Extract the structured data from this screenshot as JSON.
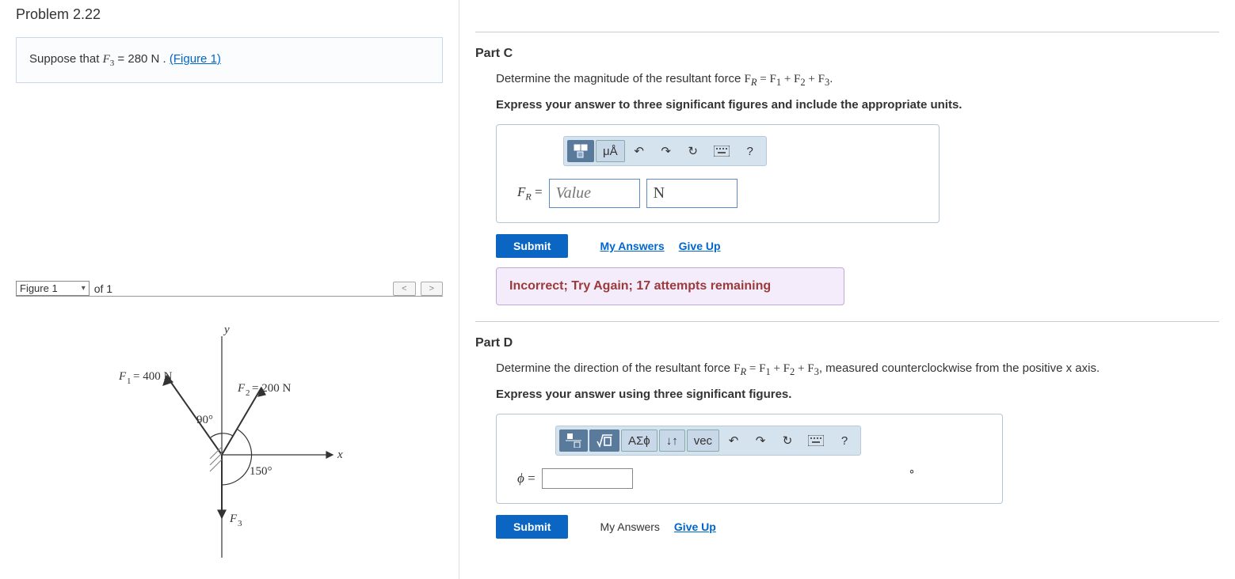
{
  "left": {
    "title": "Problem 2.22",
    "suppose_prefix": "Suppose that ",
    "f3_var": "F",
    "f3_sub": "3",
    "f3_eq": " = 280  N . ",
    "figure_link_text": "(Figure 1)",
    "figure_select": "Figure 1",
    "figure_of": "of 1",
    "fig": {
      "y_label": "y",
      "x_label": "x",
      "f1_label": "F₁ = 400 N",
      "f2_label": "F₂ = 200 N",
      "f3_label": "F₃",
      "angle90": "90°",
      "angle150": "150°"
    }
  },
  "partC": {
    "title": "Part C",
    "prompt_pre": "Determine the magnitude of the resultant force ",
    "prompt_eq": "F_R = F_1 + F_2 + F_3",
    "instruct": "Express your answer to three significant figures and include the appropriate units.",
    "lhs": "F_R =",
    "value_placeholder": "Value",
    "units_value": "N",
    "submit": "Submit",
    "my_answers": "My Answers",
    "give_up": "Give Up",
    "feedback": "Incorrect; Try Again; 17 attempts remaining",
    "tb": {
      "units": "μÅ",
      "help": "?"
    }
  },
  "partD": {
    "title": "Part D",
    "prompt_pre": "Determine the direction of the resultant force ",
    "prompt_eq": "F_R = F_1 + F_2 + F_3",
    "prompt_post": ", measured counterclockwise from the positive x axis.",
    "instruct": "Express your answer using three significant figures.",
    "lhs": "ϕ =",
    "degree": "∘",
    "submit": "Submit",
    "my_answers": "My Answers",
    "give_up": "Give Up",
    "tb": {
      "greek": "ΑΣϕ",
      "vec": "vec",
      "help": "?"
    }
  }
}
